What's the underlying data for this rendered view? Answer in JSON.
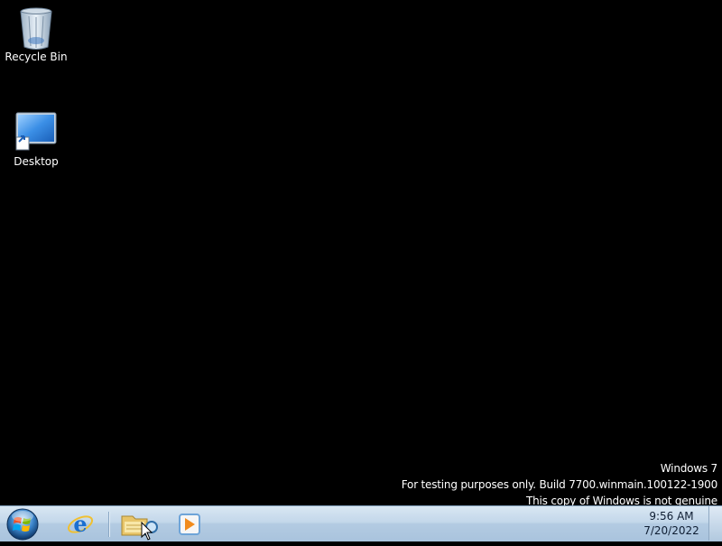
{
  "desktop": {
    "icons": [
      {
        "label": "Recycle Bin",
        "icon": "recycle-bin-icon"
      },
      {
        "label": "Desktop",
        "icon": "desktop-shortcut-icon"
      }
    ]
  },
  "watermark": {
    "line1": "Windows 7",
    "line2": "For testing purposes only. Build 7700.winmain.100122-1900",
    "line3": "This copy of Windows is not genuine"
  },
  "taskbar": {
    "start_icon": "windows-orb-icon",
    "pinned": [
      {
        "icon": "internet-explorer-icon"
      },
      {
        "icon": "windows-explorer-icon"
      },
      {
        "icon": "media-player-icon"
      }
    ],
    "clock": {
      "time": "9:56 AM",
      "date": "7/20/2022"
    }
  }
}
